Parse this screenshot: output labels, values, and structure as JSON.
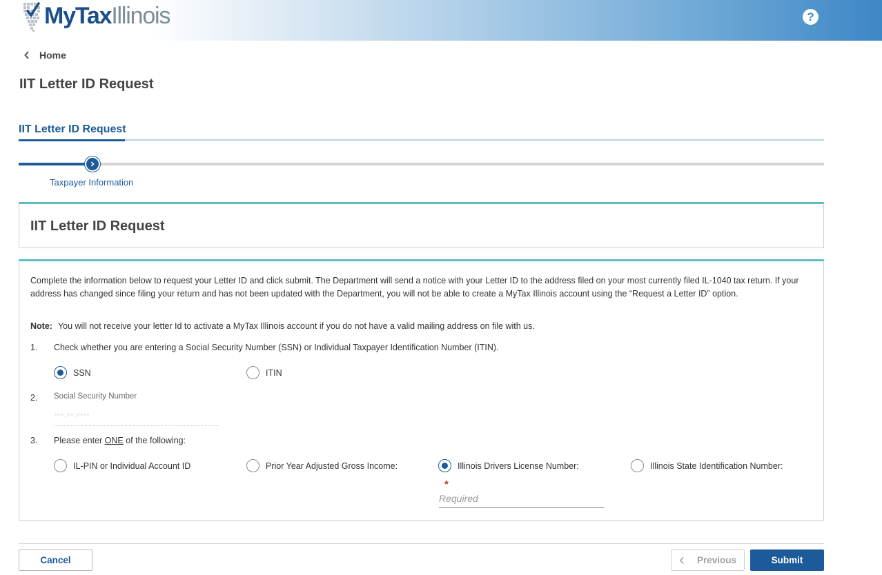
{
  "header": {
    "logo_my": "My",
    "logo_tax": "Tax",
    "logo_illinois": "Illinois",
    "help_label": "?"
  },
  "breadcrumb": {
    "home_label": "Home"
  },
  "page": {
    "title": "IIT Letter ID Request"
  },
  "section_tab": {
    "label": "IIT Letter ID Request"
  },
  "progress": {
    "step_label": "Taxpayer Information",
    "current_step": 1
  },
  "panel": {
    "title": "IIT Letter ID Request"
  },
  "form": {
    "intro": "Complete the information below to request your Letter ID and click submit. The Department will send a notice with your Letter ID to the address filed on your most currently filed IL-1040 tax return. If your address has changed since filing your return and has not been updated with the Department, you will not be able to create a MyTax Illinois account using the “Request a Letter ID” option.",
    "note_label": "Note:",
    "note_text": "You will not receive your letter Id to activate a MyTax Illinois account if you do not have a valid mailing address on file with us.",
    "q1": {
      "number": "1.",
      "text": "Check whether you are entering a Social Security Number (SSN) or Individual Taxpayer Identification Number (ITIN).",
      "options": [
        "SSN",
        "ITIN"
      ],
      "selected": "SSN"
    },
    "q2": {
      "number": "2.",
      "label": "Social Security Number",
      "value": "***-**-****"
    },
    "q3": {
      "number": "3.",
      "text_before": "Please enter ",
      "text_emph": "ONE",
      "text_after": " of the following:",
      "options": [
        "IL-PIN or Individual Account ID",
        "Prior Year Adjusted Gross Income:",
        "Illinois Drivers License Number:",
        "Illinois State Identification Number:"
      ],
      "selected": "Illinois Drivers License Number:",
      "required_mark": "*",
      "input_placeholder": "Required"
    }
  },
  "buttons": {
    "cancel": "Cancel",
    "previous": "Previous",
    "submit": "Submit"
  },
  "colors": {
    "primary": "#1d5a9a",
    "panel_accent": "#5bbcc2",
    "required": "#c0392b"
  }
}
